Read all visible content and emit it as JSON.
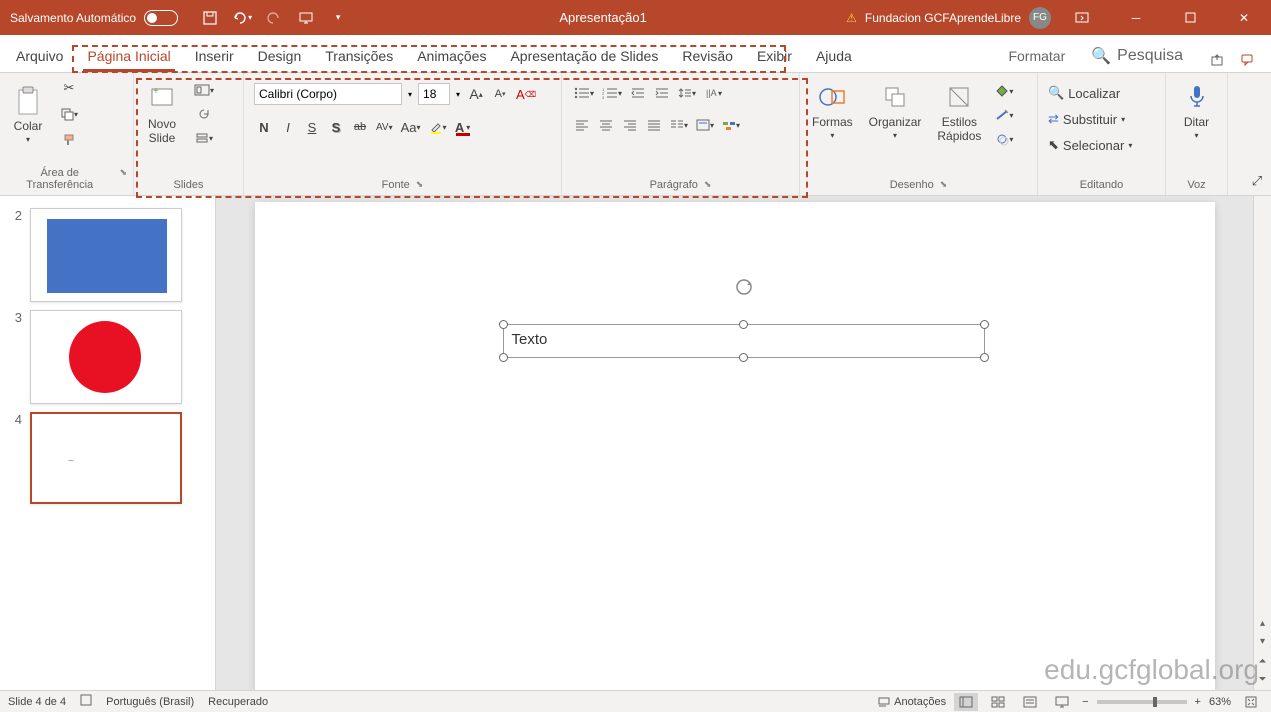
{
  "titlebar": {
    "autosave_label": "Salvamento Automático",
    "title": "Apresentação1",
    "org": "Fundacion GCFAprendeLibre",
    "user_initials": "FG"
  },
  "tabs": {
    "arquivo": "Arquivo",
    "pagina_inicial": "Página Inicial",
    "inserir": "Inserir",
    "design": "Design",
    "transicoes": "Transições",
    "animacoes": "Animações",
    "apresentacao": "Apresentação de Slides",
    "revisao": "Revisão",
    "exibir": "Exibir",
    "ajuda": "Ajuda",
    "formatar": "Formatar",
    "search": "Pesquisa"
  },
  "ribbon": {
    "clipboard": {
      "paste": "Colar",
      "group": "Área de Transferência"
    },
    "slides": {
      "new_slide": "Novo\nSlide",
      "group": "Slides"
    },
    "font": {
      "font_name": "Calibri (Corpo)",
      "font_size": "18",
      "bold": "N",
      "italic": "I",
      "underline": "S",
      "strike_s": "S",
      "strike": "ab",
      "spacing": "AV",
      "case": "Aa",
      "group": "Fonte"
    },
    "paragraph": {
      "group": "Parágrafo"
    },
    "drawing": {
      "shapes": "Formas",
      "arrange": "Organizar",
      "styles": "Estilos\nRápidos",
      "group": "Desenho"
    },
    "editing": {
      "find": "Localizar",
      "replace": "Substituir",
      "select": "Selecionar",
      "group": "Editando"
    },
    "voice": {
      "dictate": "Ditar",
      "group": "Voz"
    }
  },
  "thumbs": {
    "n2": "2",
    "n3": "3",
    "n4": "4"
  },
  "canvas": {
    "textbox_text": "Texto"
  },
  "status": {
    "slide_info": "Slide 4 de 4",
    "lang": "Português (Brasil)",
    "recovered": "Recuperado",
    "notes": "Anotações",
    "zoom": "63%"
  },
  "watermark": "edu.gcfglobal.org"
}
